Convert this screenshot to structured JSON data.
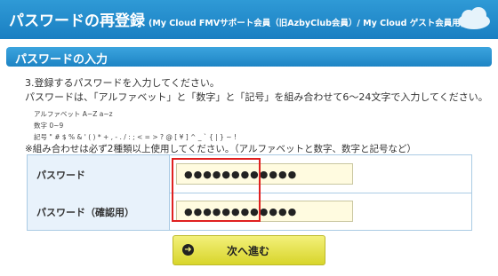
{
  "header": {
    "title": "パスワードの再登録",
    "subtitle": "(My Cloud FMVサポート会員（旧AzbyClub会員）/ My Cloud ゲスト会員用)"
  },
  "section": {
    "title": "パスワードの入力"
  },
  "instructions": {
    "line1": "3.登録するパスワードを入力してください。",
    "line2": "パスワードは、「アルファベット」と「数字」と「記号」を組み合わせて6～24文字で入力してください。",
    "alpha": "アルファベット A~Z a~z",
    "digits": "数字 0~9",
    "symbols": "記号 \" # $ % & ' ( ) * + , - . / : ; < = > ? @ [ ¥ ] ^ _ ` { | } ~ !",
    "note": "※組み合わせは必ず2種類以上使用してください。（アルファベットと数字、数字と記号など）"
  },
  "form": {
    "password_label": "パスワード",
    "password_value": "●●●●●●●●●●●●",
    "confirm_label": "パスワード（確認用）",
    "confirm_value": "●●●●●●●●●●●●"
  },
  "button": {
    "label": "次へ進む"
  },
  "colors": {
    "header": "#2f9ad6",
    "highlight": "#e02020",
    "button": "#e8e54a"
  }
}
